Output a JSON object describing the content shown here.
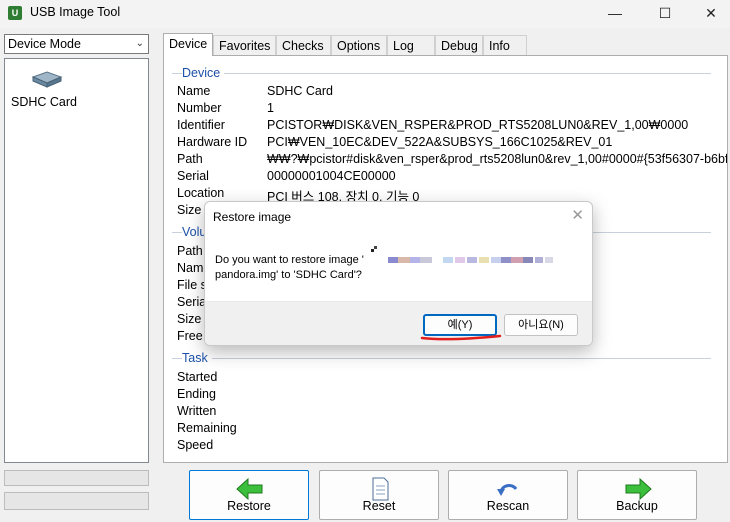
{
  "window": {
    "title": "USB Image Tool",
    "minimize": "—",
    "maximize": "☐",
    "close": "✕",
    "app_icon": "U"
  },
  "left": {
    "mode_select": "Device Mode",
    "devices": [
      {
        "label": "SDHC Card",
        "icon": "sd-card-icon"
      }
    ]
  },
  "tabs": [
    "Device",
    "Favorites",
    "Checks",
    "Options",
    "Log",
    "Debug",
    "Info"
  ],
  "device_section": {
    "title": "Device",
    "rows": [
      {
        "label": "Name",
        "value": "SDHC Card"
      },
      {
        "label": "Number",
        "value": "1"
      },
      {
        "label": "Identifier",
        "value": "PCISTOR₩DISK&VEN_RSPER&PROD_RTS5208LUN0&REV_1,00₩0000"
      },
      {
        "label": "Hardware ID",
        "value": "PCI₩VEN_10EC&DEV_522A&SUBSYS_166C1025&REV_01"
      },
      {
        "label": "Path",
        "value": "₩₩?₩pcistor#disk&ven_rsper&prod_rts5208lun0&rev_1,00#0000#{53f56307-b6bf-"
      },
      {
        "label": "Serial",
        "value": "00000001004CE00000"
      },
      {
        "label": "Location",
        "value": "PCI 버스 108, 장치 0, 기능 0"
      },
      {
        "label": "Size",
        "value": ""
      }
    ]
  },
  "volume_section": {
    "title": "Volume",
    "rows": [
      "Path",
      "Name",
      "File system",
      "Serial",
      "Size",
      "Free"
    ]
  },
  "task_section": {
    "title": "Task",
    "rows": [
      "Started",
      "Ending",
      "Written",
      "Remaining",
      "Speed"
    ]
  },
  "buttons": {
    "restore": "Restore",
    "reset": "Reset",
    "rescan": "Rescan",
    "backup": "Backup"
  },
  "dialog": {
    "title": "Restore image",
    "close": "✕",
    "message_line1": "Do you want to restore image '",
    "message_line2": "pandora.img' to 'SDHC Card'?",
    "yes": "예(Y)",
    "no": "아니요(N)"
  },
  "colors": {
    "accent": "#0067c0",
    "section_title": "#1c50a8",
    "annotation": "#e11d1d",
    "arrow_green": "#3cbf3c"
  }
}
